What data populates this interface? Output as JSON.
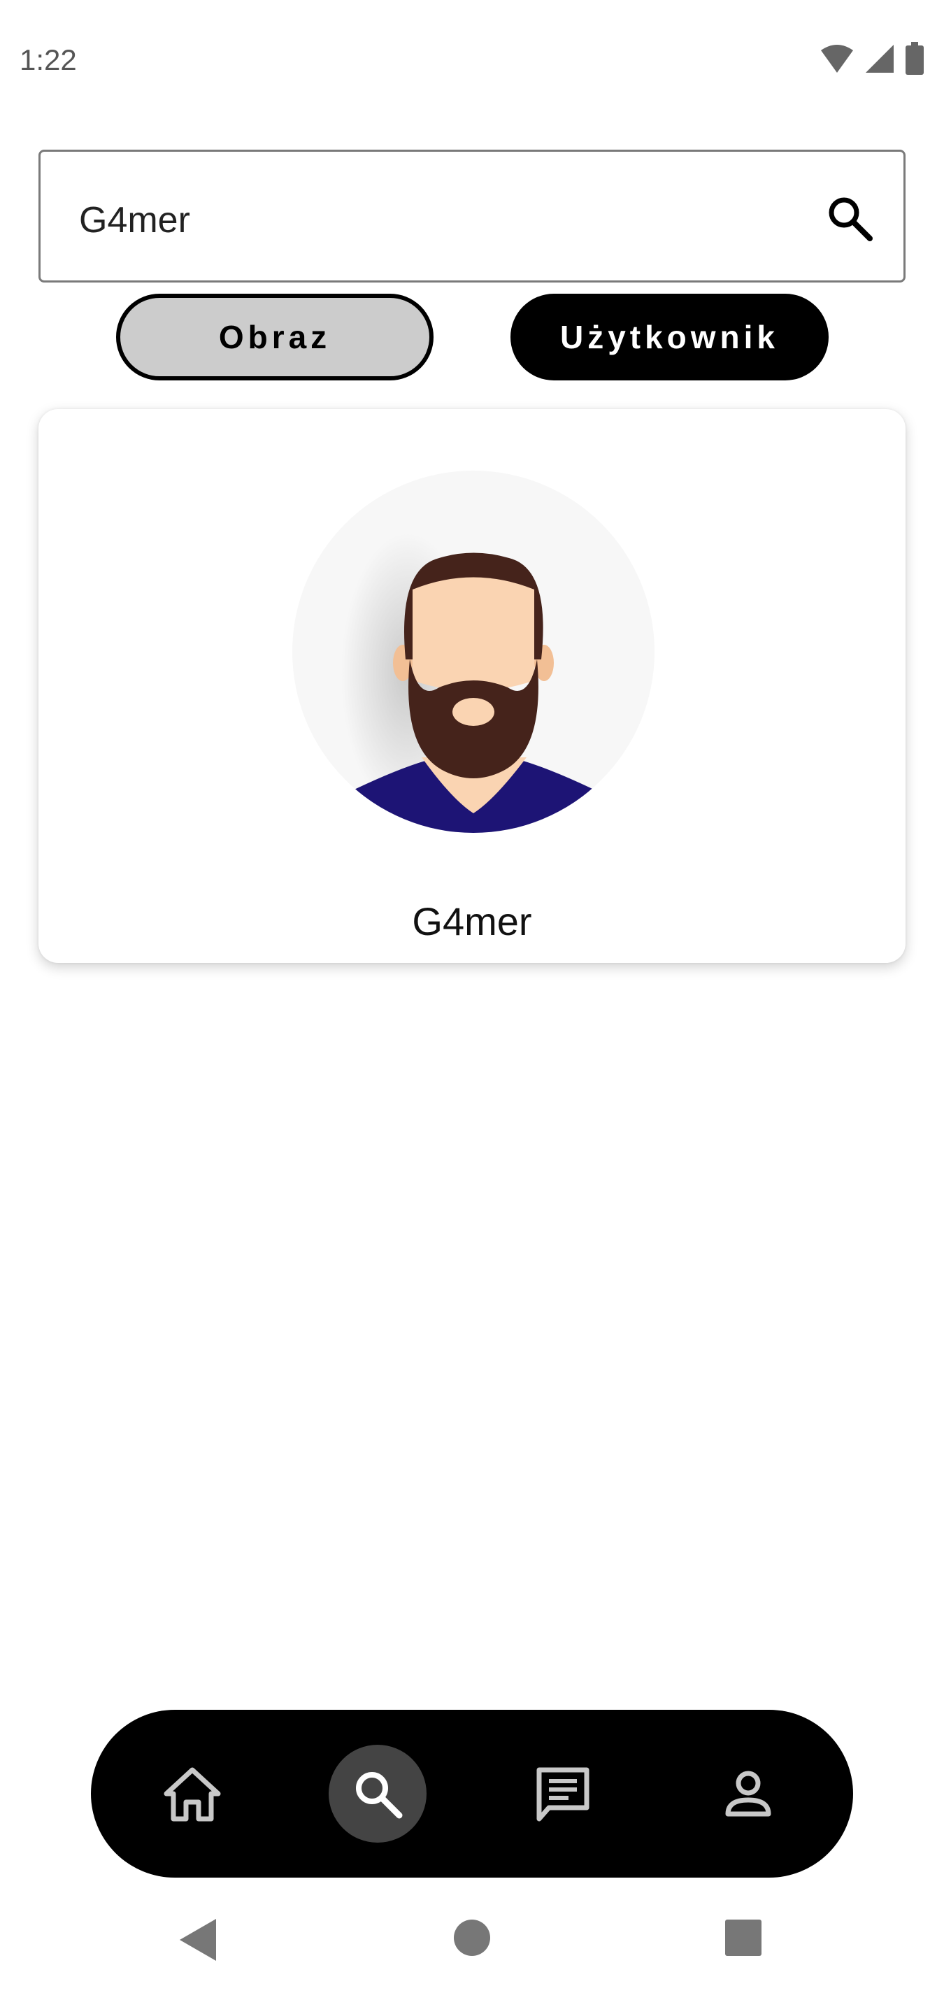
{
  "status_bar": {
    "time": "1:22",
    "icons": [
      "wifi-icon",
      "cellular-signal-icon",
      "battery-icon"
    ]
  },
  "search": {
    "value": "G4mer",
    "icon": "search-icon"
  },
  "filters": {
    "image_label": "Obraz",
    "user_label": "Użytkownik",
    "selected": "Użytkownik"
  },
  "results": [
    {
      "username": "G4mer",
      "avatar": "bearded-man-avatar"
    }
  ],
  "bottom_nav": {
    "items": [
      "home-icon",
      "search-icon",
      "messages-icon",
      "profile-icon"
    ],
    "active": "search-icon"
  },
  "system_nav": [
    "back-icon",
    "home-circle-icon",
    "recents-icon"
  ],
  "colors": {
    "accent": "#000000",
    "chip_inactive": "#cccccc",
    "nav_active": "#444444",
    "avatar_bg": "#f7f7f7",
    "hair": "#45231b",
    "skin": "#fad4b2",
    "shirt": "#1d1475"
  }
}
